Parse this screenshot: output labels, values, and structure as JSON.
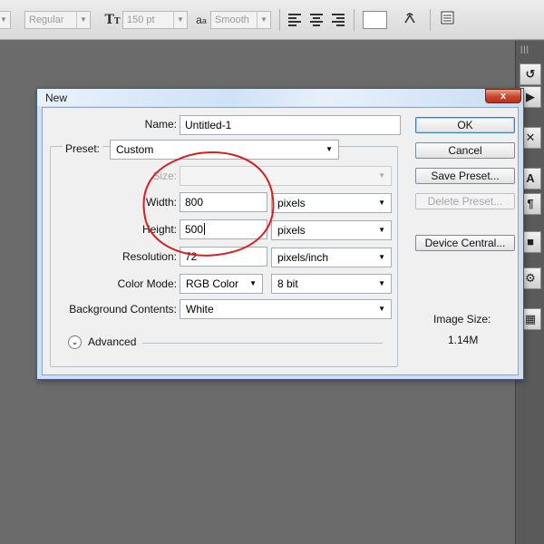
{
  "options_bar": {
    "font_style": "Regular",
    "font_size": "150 pt",
    "antialias": "Smooth",
    "icons": [
      "font-size-icon",
      "antialias-icon",
      "align-left-icon",
      "align-center-icon",
      "align-right-icon",
      "warp-text-icon",
      "character-panel-icon"
    ]
  },
  "dialog": {
    "title": "New",
    "close_glyph": "x",
    "name_label": "Name:",
    "name_value": "Untitled-1",
    "preset_label": "Preset:",
    "preset_value": "Custom",
    "size_label": "Size:",
    "size_value": "",
    "width_label": "Width:",
    "width_value": "800",
    "width_unit": "pixels",
    "height_label": "Height:",
    "height_value": "500",
    "height_unit": "pixels",
    "resolution_label": "Resolution:",
    "resolution_value": "72",
    "resolution_unit": "pixels/inch",
    "color_mode_label": "Color Mode:",
    "color_mode_value": "RGB Color",
    "bit_depth_value": "8 bit",
    "background_label": "Background Contents:",
    "background_value": "White",
    "advanced_label": "Advanced",
    "ok_button": "OK",
    "cancel_button": "Cancel",
    "save_preset_button": "Save Preset...",
    "delete_preset_button": "Delete Preset...",
    "device_central_button": "Device Central...",
    "image_size_label": "Image Size:",
    "image_size_value": "1.14M"
  },
  "annotation": {
    "color": "#d42020",
    "target": "width-height-fields"
  },
  "colors": {
    "workspace": "#6b6b6b",
    "accent": "#3c7fb1"
  }
}
